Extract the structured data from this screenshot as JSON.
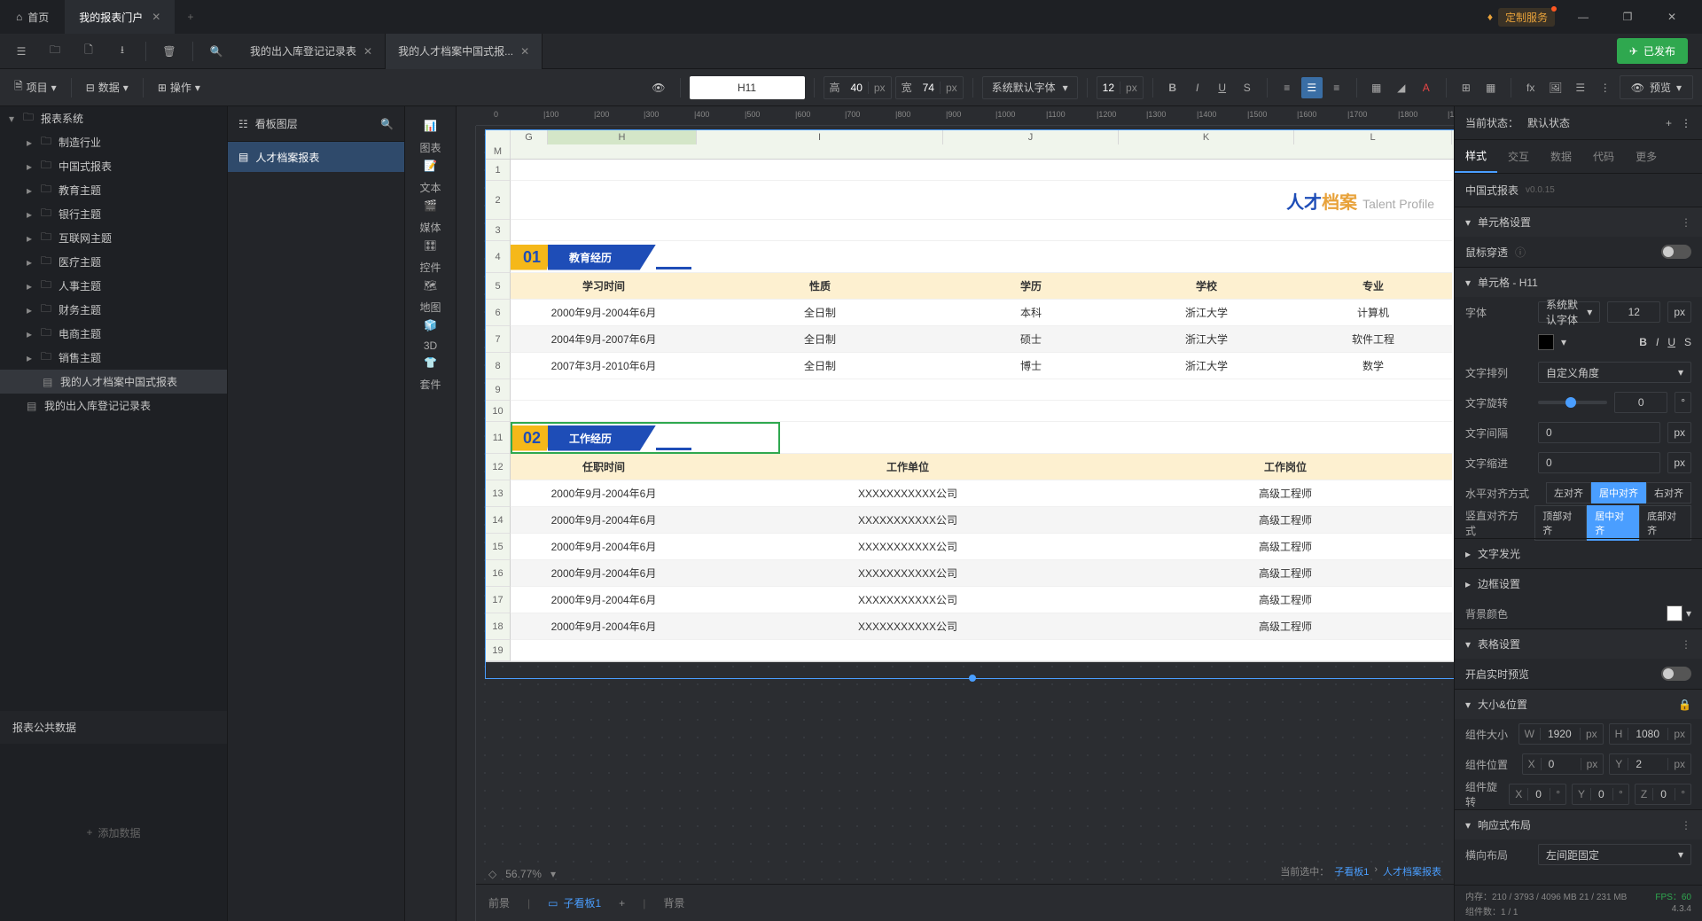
{
  "titlebar": {
    "home": "首页",
    "portal": "我的报表门户",
    "premium": "定制服务"
  },
  "docTabs": {
    "tab1": "我的出入库登记记录表",
    "tab2": "我的人才档案中国式报..."
  },
  "publish": "已发布",
  "tb2": {
    "project": "项目",
    "data": "数据",
    "operate": "操作",
    "cellRef": "H11",
    "hLabel": "高",
    "hVal": "40",
    "wLabel": "宽",
    "wVal": "74",
    "px": "px",
    "font": "系统默认字体",
    "fontSize": "12",
    "preview": "预览"
  },
  "tree": {
    "root": "报表系统",
    "items": [
      "制造行业",
      "中国式报表",
      "教育主题",
      "银行主题",
      "互联网主题",
      "医疗主题",
      "人事主题",
      "财务主题",
      "电商主题",
      "销售主题"
    ],
    "sel": "我的人才档案中国式报表",
    "other": "我的出入库登记记录表",
    "public": "报表公共数据",
    "addData": "添加数据"
  },
  "layers": {
    "title": "看板图层",
    "item": "人才档案报表"
  },
  "rail": [
    "图表",
    "文本",
    "媒体",
    "控件",
    "地图",
    "3D",
    "套件"
  ],
  "cols": [
    "",
    "G",
    "H",
    "I",
    "J",
    "K",
    "L",
    "M"
  ],
  "talent": {
    "cn1": "人才",
    "cn2": "档案",
    "en": "Talent Profile"
  },
  "sec1": {
    "num": "01",
    "title": "教育经历"
  },
  "sec2": {
    "num": "02",
    "title": "工作经历"
  },
  "eduHead": [
    "学习时间",
    "性质",
    "学历",
    "学校",
    "专业"
  ],
  "eduRows": [
    [
      "2000年9月-2004年6月",
      "全日制",
      "本科",
      "浙江大学",
      "计算机"
    ],
    [
      "2004年9月-2007年6月",
      "全日制",
      "硕士",
      "浙江大学",
      "软件工程"
    ],
    [
      "2007年3月-2010年6月",
      "全日制",
      "博士",
      "浙江大学",
      "数学"
    ]
  ],
  "workHead": [
    "任职时间",
    "工作单位",
    "工作岗位"
  ],
  "workRows": [
    [
      "2000年9月-2004年6月",
      "XXXXXXXXXXX公司",
      "高级工程师"
    ],
    [
      "2000年9月-2004年6月",
      "XXXXXXXXXXX公司",
      "高级工程师"
    ],
    [
      "2000年9月-2004年6月",
      "XXXXXXXXXXX公司",
      "高级工程师"
    ],
    [
      "2000年9月-2004年6月",
      "XXXXXXXXXXX公司",
      "高级工程师"
    ],
    [
      "2000年9月-2004年6月",
      "XXXXXXXXXXX公司",
      "高级工程师"
    ],
    [
      "2000年9月-2004年6月",
      "XXXXXXXXXXX公司",
      "高级工程师"
    ]
  ],
  "canvasFoot": {
    "label": "当前选中：",
    "path1": "子看板1",
    "path2": "人才档案报表"
  },
  "bottomTabs": {
    "front": "前景",
    "sub": "子看板1",
    "back": "背景"
  },
  "zoom": "56.77%",
  "right": {
    "stateLabel": "当前状态：",
    "stateVal": "默认状态",
    "tabs": [
      "样式",
      "交互",
      "数据",
      "代码",
      "更多"
    ],
    "compTitle": "中国式报表",
    "ver": "v0.0.15",
    "acc1": "单元格设置",
    "mouse": "鼠标穿透",
    "acc2": "单元格 - H11",
    "font": "字体",
    "fontVal": "系统默认字体",
    "fontSize": "12",
    "px": "px",
    "textArr": "文字排列",
    "textArrVal": "自定义角度",
    "rotate": "文字旋转",
    "rotateVal": "0",
    "deg": "°",
    "spacing": "文字间隔",
    "spacingVal": "0",
    "indent": "文字缩进",
    "indentVal": "0",
    "halign": "水平对齐方式",
    "halignOpts": [
      "左对齐",
      "居中对齐",
      "右对齐"
    ],
    "valign": "竖直对齐方式",
    "valignOpts": [
      "顶部对齐",
      "居中对齐",
      "底部对齐"
    ],
    "glow": "文字发光",
    "border": "边框设置",
    "bgColor": "背景颜色",
    "acc3": "表格设置",
    "realtime": "开启实时预览",
    "acc4": "大小&位置",
    "size": "组件大小",
    "w": "W",
    "wVal": "1920",
    "h": "H",
    "hVal": "1080",
    "pos": "组件位置",
    "x": "X",
    "xVal": "0",
    "y": "Y",
    "yVal": "2",
    "compRot": "组件旋转",
    "rx": "X",
    "rxVal": "0",
    "ry": "Y",
    "ryVal": "0",
    "rz": "Z",
    "rzVal": "0",
    "acc5": "响应式布局",
    "hlayout": "横向布局",
    "hlayoutVal": "左间距固定"
  },
  "status": {
    "mem": "内存：210 / 3793 / 4096 MB  21 / 231 MB",
    "comp": "组件数：1 / 1",
    "fps": "FPS：60",
    "ver": "4.3.4"
  }
}
